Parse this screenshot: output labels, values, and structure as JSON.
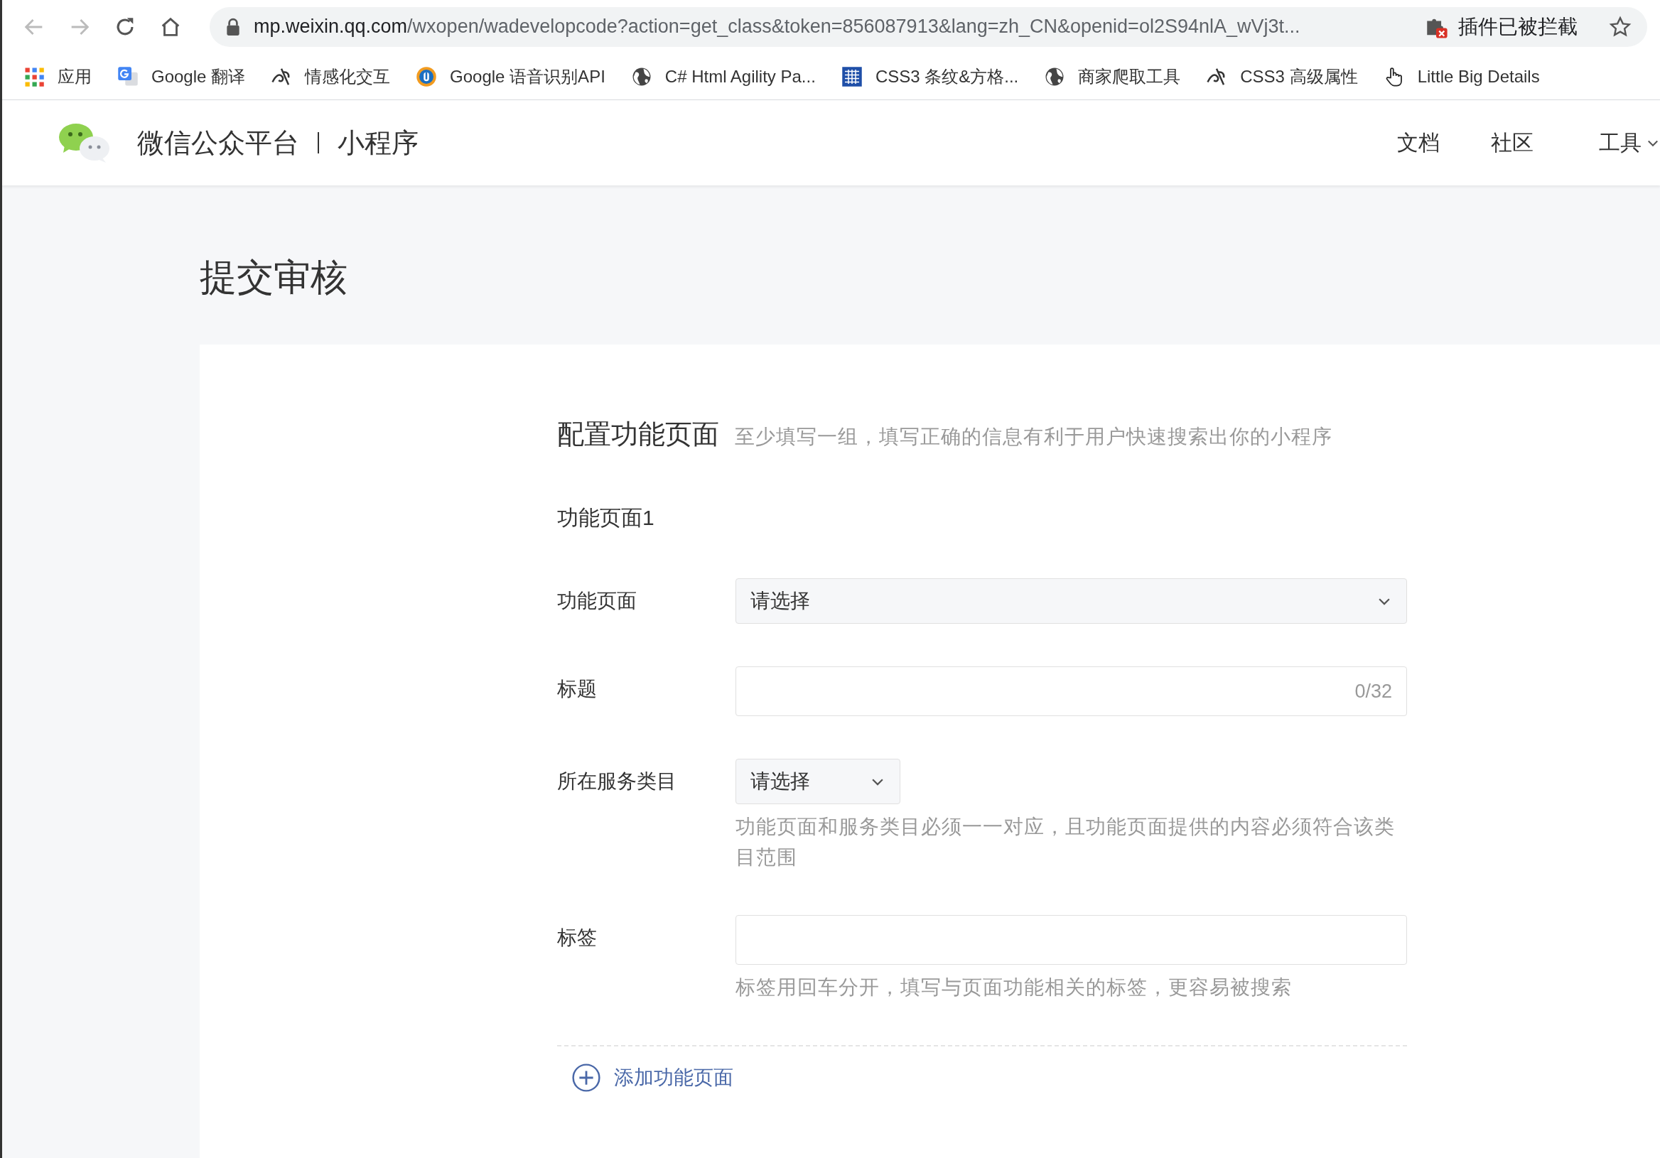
{
  "browser": {
    "url_host": "mp.weixin.qq.com",
    "url_rest": "/wxopen/wadevelopcode?action=get_class&token=856087913&lang=zh_CN&openid=ol2S94nlA_wVj3t...",
    "extension_label": "插件已被拦截",
    "bookmarks": [
      {
        "kind": "apps",
        "label": "应用"
      },
      {
        "kind": "translate",
        "label": "Google 翻译"
      },
      {
        "kind": "swirl",
        "label": "情感化交互"
      },
      {
        "kind": "badge",
        "label": "Google 语音识别API"
      },
      {
        "kind": "globe",
        "label": "C# Html Agility Pa..."
      },
      {
        "kind": "grid",
        "label": "CSS3 条纹&方格..."
      },
      {
        "kind": "globe",
        "label": "商家爬取工具"
      },
      {
        "kind": "swirl",
        "label": "CSS3 高级属性"
      },
      {
        "kind": "hand",
        "label": "Little Big Details"
      }
    ]
  },
  "header": {
    "brand": "微信公众平台",
    "product": "小程序",
    "nav": [
      {
        "label": "文档",
        "dropdown": false
      },
      {
        "label": "社区",
        "dropdown": false
      },
      {
        "label": "工具",
        "dropdown": true
      }
    ]
  },
  "page_title": "提交审核",
  "section": {
    "title": "配置功能页面",
    "hint": "至少填写一组，填写正确的信息有利于用户快速搜索出你的小程序",
    "group_title": "功能页面1",
    "fields": [
      {
        "kind": "select",
        "label": "功能页面",
        "placeholder": "请选择"
      },
      {
        "kind": "input",
        "label": "标题",
        "counter": "0/32"
      },
      {
        "kind": "select-small",
        "label": "所在服务类目",
        "placeholder": "请选择",
        "help": "功能页面和服务类目必须一一对应，且功能页面提供的内容必须符合该类目范围"
      },
      {
        "kind": "input",
        "label": "标签",
        "help": "标签用回车分开，填写与页面功能相关的标签，更容易被搜索"
      }
    ],
    "add_button": "添加功能页面"
  }
}
